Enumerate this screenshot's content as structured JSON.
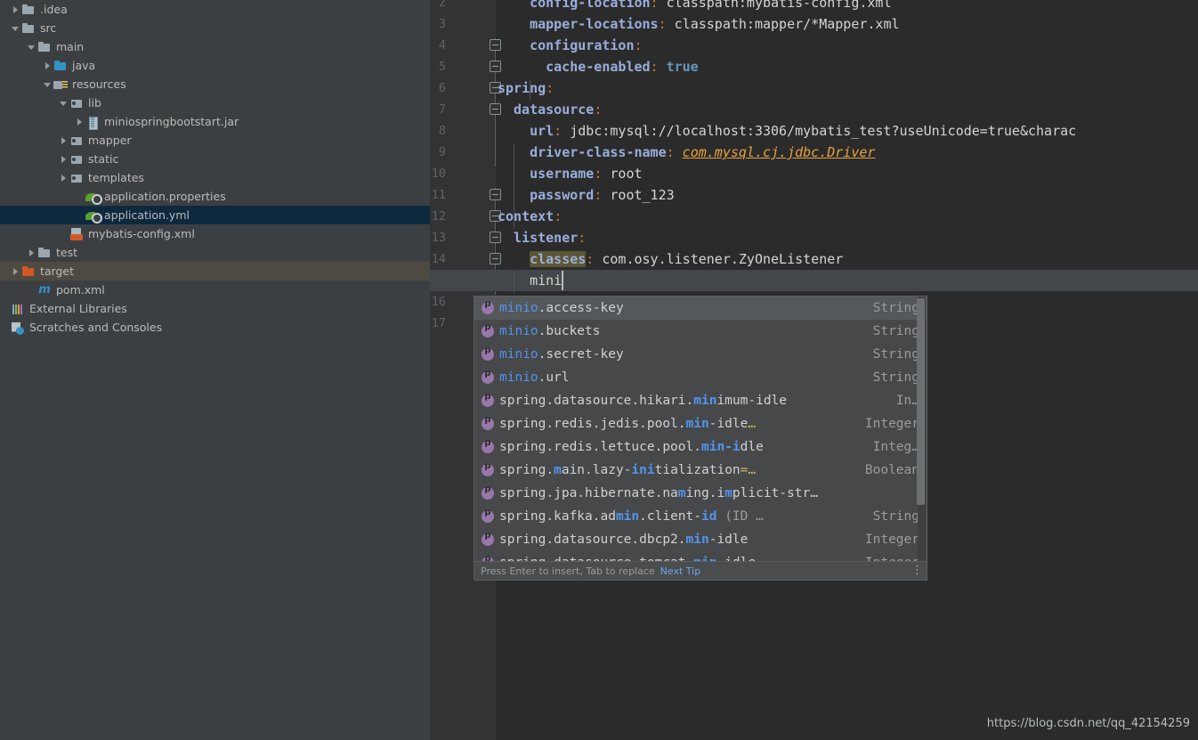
{
  "sidebar": {
    "name": "project-tree",
    "items": [
      {
        "label": ".idea",
        "indent": 0,
        "arrow": "collapsed",
        "icon": "folder-icon",
        "state": "normal"
      },
      {
        "label": "src",
        "indent": 0,
        "arrow": "expanded",
        "icon": "folder-icon",
        "state": "normal"
      },
      {
        "label": "main",
        "indent": 1,
        "arrow": "expanded",
        "icon": "folder-icon",
        "state": "normal"
      },
      {
        "label": "java",
        "indent": 2,
        "arrow": "collapsed",
        "icon": "folder-blue-icon",
        "state": "normal"
      },
      {
        "label": "resources",
        "indent": 2,
        "arrow": "expanded",
        "icon": "folder-resources-icon",
        "state": "normal"
      },
      {
        "label": "lib",
        "indent": 3,
        "arrow": "expanded",
        "icon": "folder-sub-icon",
        "state": "normal"
      },
      {
        "label": "miniospringbootstart.jar",
        "indent": 4,
        "arrow": "collapsed",
        "icon": "jar-icon",
        "state": "normal"
      },
      {
        "label": "mapper",
        "indent": 3,
        "arrow": "collapsed",
        "icon": "folder-sub-icon",
        "state": "normal"
      },
      {
        "label": "static",
        "indent": 3,
        "arrow": "collapsed",
        "icon": "folder-sub-icon",
        "state": "normal"
      },
      {
        "label": "templates",
        "indent": 3,
        "arrow": "collapsed",
        "icon": "folder-sub-icon",
        "state": "normal"
      },
      {
        "label": "application.properties",
        "indent": 4,
        "arrow": "none",
        "icon": "spring-file-icon",
        "state": "normal"
      },
      {
        "label": "application.yml",
        "indent": 4,
        "arrow": "none",
        "icon": "spring-file-icon",
        "state": "selected-file"
      },
      {
        "label": "mybatis-config.xml",
        "indent": 3,
        "arrow": "none",
        "icon": "xml-file-icon",
        "state": "normal"
      },
      {
        "label": "test",
        "indent": 1,
        "arrow": "collapsed",
        "icon": "folder-icon",
        "state": "normal"
      },
      {
        "label": "target",
        "indent": 0,
        "arrow": "collapsed",
        "icon": "folder-orange-icon",
        "state": "selected-target"
      },
      {
        "label": "pom.xml",
        "indent": 1,
        "arrow": "none",
        "icon": "maven-icon",
        "state": "normal"
      },
      {
        "label": "External Libraries",
        "indent": -1,
        "arrow": "none",
        "icon": "external-libraries-icon",
        "state": "normal"
      },
      {
        "label": "Scratches and Consoles",
        "indent": -1,
        "arrow": "none",
        "icon": "scratches-icon",
        "state": "normal"
      }
    ]
  },
  "editor": {
    "name": "yaml-editor",
    "file": "application.yml",
    "line_numbers": [
      "2",
      "3",
      "4",
      "5",
      "6",
      "7",
      "8",
      "9",
      "10",
      "11",
      "12",
      "13",
      "14",
      "16",
      "17"
    ],
    "lines": [
      {
        "num": "2",
        "indent": 4,
        "key": "config-location",
        "colon": ":",
        "value": "classpath:mybatis-config.xml"
      },
      {
        "num": "3",
        "indent": 4,
        "key": "mapper-locations",
        "colon": ":",
        "value": "classpath:mapper/*Mapper.xml"
      },
      {
        "num": "4",
        "indent": 4,
        "key": "configuration",
        "colon": ":",
        "value": ""
      },
      {
        "num": "5",
        "indent": 6,
        "key": "cache-enabled",
        "colon": ":",
        "value": "true",
        "value_kind": "boolean"
      },
      {
        "num": "6",
        "indent": 0,
        "key": "spring",
        "colon": ":",
        "value": ""
      },
      {
        "num": "7",
        "indent": 2,
        "key": "datasource",
        "colon": ":",
        "value": ""
      },
      {
        "num": "8",
        "indent": 4,
        "key": "url",
        "colon": ":",
        "value": "jdbc:mysql://localhost:3306/mybatis_test?useUnicode=true&charac"
      },
      {
        "num": "9",
        "indent": 4,
        "key": "driver-class-name",
        "colon": ":",
        "value": "com.mysql.cj.jdbc.Driver",
        "value_kind": "class"
      },
      {
        "num": "10",
        "indent": 4,
        "key": "username",
        "colon": ":",
        "value": "root"
      },
      {
        "num": "11",
        "indent": 4,
        "key": "password",
        "colon": ":",
        "value": "root_123"
      },
      {
        "num": "12",
        "indent": 0,
        "key": "context",
        "colon": ":",
        "value": ""
      },
      {
        "num": "13",
        "indent": 2,
        "key": "listener",
        "colon": ":",
        "value": ""
      },
      {
        "num": "14",
        "indent": 4,
        "key": "classes",
        "colon": ":",
        "value": "com.osy.listener.ZyOneListener",
        "key_highlighted": true
      }
    ],
    "caret_line_text": "mini"
  },
  "completion_popup": {
    "name": "code-completion-popup",
    "items": [
      {
        "prefix": "minio.",
        "match": "",
        "rest": "access-key",
        "type": "String",
        "selected": true,
        "segments": [
          {
            "t": "minio",
            "c": "m"
          },
          {
            "t": ".access-key",
            "c": ""
          }
        ]
      },
      {
        "type": "String",
        "segments": [
          {
            "t": "minio",
            "c": "m"
          },
          {
            "t": ".buckets",
            "c": ""
          }
        ]
      },
      {
        "type": "String",
        "segments": [
          {
            "t": "minio",
            "c": "m"
          },
          {
            "t": ".secret-key",
            "c": ""
          }
        ]
      },
      {
        "type": "String",
        "segments": [
          {
            "t": "minio",
            "c": "m"
          },
          {
            "t": ".url",
            "c": ""
          }
        ]
      },
      {
        "type": "In…",
        "segments": [
          {
            "t": "spring.datasource.hikari.",
            "c": ""
          },
          {
            "t": "min",
            "c": "mb"
          },
          {
            "t": "imum-idle",
            "c": ""
          }
        ]
      },
      {
        "type": "Integer",
        "segments": [
          {
            "t": "spring.redis.jedis.pool.",
            "c": ""
          },
          {
            "t": "min",
            "c": "mb"
          },
          {
            "t": "-idle",
            "c": ""
          },
          {
            "t": "…",
            "c": "el"
          }
        ]
      },
      {
        "type": "Integ…",
        "segments": [
          {
            "t": "spring.redis.lettuce.pool.",
            "c": ""
          },
          {
            "t": "min",
            "c": "mb"
          },
          {
            "t": "-i",
            "c": "mb"
          },
          {
            "t": "dle",
            "c": ""
          }
        ]
      },
      {
        "type": "Boolean",
        "segments": [
          {
            "t": "spring.",
            "c": ""
          },
          {
            "t": "m",
            "c": "mb"
          },
          {
            "t": "ain.lazy-",
            "c": ""
          },
          {
            "t": "ini",
            "c": "mb"
          },
          {
            "t": "tialization",
            "c": ""
          },
          {
            "t": "=…",
            "c": "el"
          }
        ]
      },
      {
        "type": "",
        "segments": [
          {
            "t": "spring.jpa.hibernate.na",
            "c": ""
          },
          {
            "t": "m",
            "c": "mb"
          },
          {
            "t": "ing.i",
            "c": ""
          },
          {
            "t": "m",
            "c": "mb"
          },
          {
            "t": "plicit-str…",
            "c": ""
          }
        ]
      },
      {
        "type": "String",
        "segments": [
          {
            "t": "spring.kafka.ad",
            "c": ""
          },
          {
            "t": "min",
            "c": "mb"
          },
          {
            "t": ".client-",
            "c": ""
          },
          {
            "t": "id",
            "c": "mb"
          },
          {
            "t": " (ID …",
            "c": "dim"
          }
        ]
      },
      {
        "type": "Integer",
        "segments": [
          {
            "t": "spring.datasource.dbcp2.",
            "c": ""
          },
          {
            "t": "min",
            "c": "mb"
          },
          {
            "t": "-idle",
            "c": ""
          }
        ]
      },
      {
        "type": "Integer",
        "segments": [
          {
            "t": "spring.datasource.tomcat.",
            "c": ""
          },
          {
            "t": "min",
            "c": "mb"
          },
          {
            "t": "-idle",
            "c": ""
          }
        ]
      }
    ],
    "footer_hint": "Press Enter to insert, Tab to replace",
    "footer_link": "Next Tip",
    "kebab": "⋮"
  },
  "watermark": {
    "text": "https://blog.csdn.net/qq_42154259"
  },
  "colors": {
    "sidebar_bg": "#3c3f41",
    "editor_bg": "#2b2b2b",
    "gutter_bg": "#313335",
    "selection_blue": "#0d293e",
    "selection_target": "#4e4a41",
    "popup_bg": "#46484a",
    "popup_selected": "#55585a",
    "key_color": "#9aaedc",
    "colon_color": "#cc7832",
    "value_color": "#d5d5d5",
    "boolean_color": "#6897bb",
    "class_color": "#e8a33d",
    "match_color": "#5394ec",
    "accent_purple": "#9876aa"
  }
}
